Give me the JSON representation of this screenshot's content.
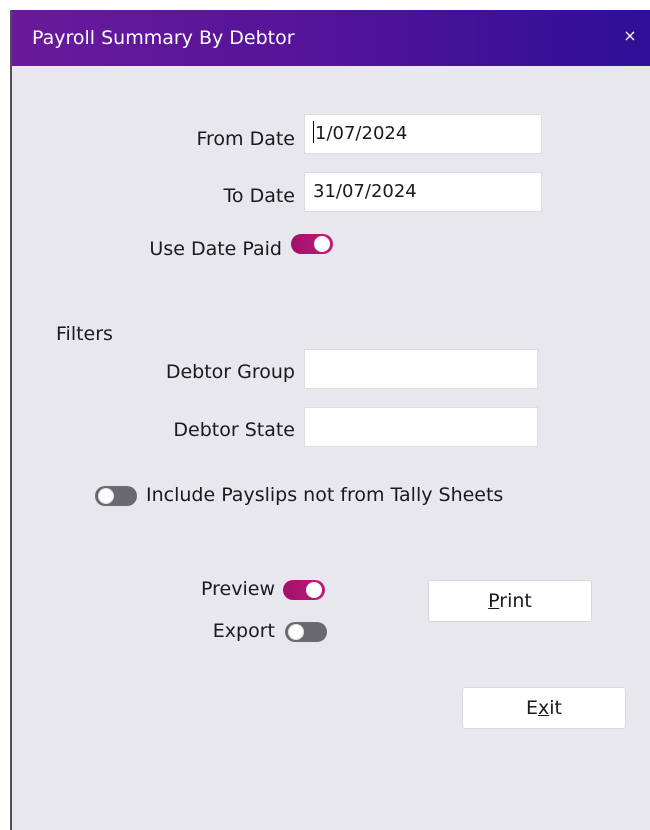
{
  "window": {
    "title": "Payroll Summary By Debtor",
    "close_glyph": "×"
  },
  "dates": {
    "from_label": "From Date",
    "from_value": "1/07/2024",
    "to_label": "To Date",
    "to_value": "31/07/2024",
    "use_date_paid_label": "Use Date Paid",
    "use_date_paid_on": true
  },
  "filters": {
    "heading": "Filters",
    "debtor_group_label": "Debtor Group",
    "debtor_group_value": "",
    "debtor_state_label": "Debtor State",
    "debtor_state_value": ""
  },
  "options": {
    "include_payslips_label": "Include Payslips not from Tally Sheets",
    "include_payslips_on": false,
    "preview_label": "Preview",
    "preview_on": true,
    "export_label": "Export",
    "export_on": false
  },
  "actions": {
    "print_mnemonic": "P",
    "print_rest": "rint",
    "exit_pre": "E",
    "exit_mnemonic": "x",
    "exit_post": "it"
  },
  "colors": {
    "title_gradient_start": "#6a1a9a",
    "title_gradient_end": "#2e0f96",
    "toggle_on": "#c21b78",
    "toggle_off": "#6a6a6e",
    "window_bg": "#e7e7ed"
  }
}
